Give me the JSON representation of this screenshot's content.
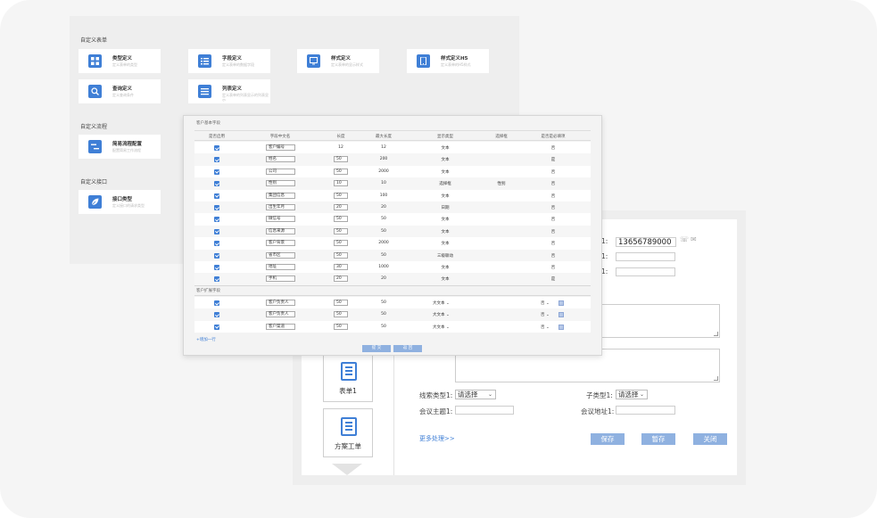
{
  "custom_form": {
    "section_title": "自定义表单",
    "cards": [
      {
        "title": "类型定义",
        "desc": "定义表单的类型",
        "icon": "grid-icon"
      },
      {
        "title": "字段定义",
        "desc": "定义表单的数据字段",
        "icon": "list-icon"
      },
      {
        "title": "样式定义",
        "desc": "定义表单的显示样式",
        "icon": "monitor-icon"
      },
      {
        "title": "样式定义H5",
        "desc": "定义表单的H5样式",
        "icon": "tablet-icon"
      },
      {
        "title": "查询定义",
        "desc": "定义查询条件",
        "icon": "search-icon"
      },
      {
        "title": "列表定义",
        "desc": "定义表单的列表显示的列表显示",
        "icon": "menu-icon"
      }
    ]
  },
  "custom_flow": {
    "section_title": "自定义流程",
    "card": {
      "title": "简易流程配置",
      "desc": "配置简易工作流程",
      "icon": "flow-icon"
    }
  },
  "custom_api": {
    "section_title": "自定义接口",
    "card": {
      "title": "接口类型",
      "desc": "定义接口的请求类型",
      "icon": "leaf-icon"
    }
  },
  "field_table": {
    "base_title": "客户基本字段",
    "columns": [
      "是否启用",
      "字段中文名",
      "长度",
      "最大长度",
      "显示类型",
      "选择框",
      "是否是必填项"
    ],
    "base_rows": [
      {
        "name": "客户编号",
        "len": "12",
        "max": "12",
        "type": "文本",
        "select": "",
        "required": "否",
        "len_box": false
      },
      {
        "name": "姓名",
        "len": "50",
        "max": "200",
        "type": "文本",
        "select": "",
        "required": "是",
        "len_box": true
      },
      {
        "name": "公司",
        "len": "50",
        "max": "2000",
        "type": "文本",
        "select": "",
        "required": "否",
        "len_box": true
      },
      {
        "name": "性别",
        "len": "10",
        "max": "10",
        "type": "选择框",
        "select": "性别",
        "required": "否",
        "len_box": true
      },
      {
        "name": "集团信息",
        "len": "50",
        "max": "100",
        "type": "文本",
        "select": "",
        "required": "否",
        "len_box": true
      },
      {
        "name": "出生年月",
        "len": "20",
        "max": "20",
        "type": "日期",
        "select": "",
        "required": "否",
        "len_box": true
      },
      {
        "name": "微信号",
        "len": "50",
        "max": "50",
        "type": "文本",
        "select": "",
        "required": "否",
        "len_box": true
      },
      {
        "name": "信息来源",
        "len": "50",
        "max": "50",
        "type": "文本",
        "select": "",
        "required": "否",
        "len_box": true
      },
      {
        "name": "客户背景",
        "len": "50",
        "max": "2000",
        "type": "文本",
        "select": "",
        "required": "否",
        "len_box": true
      },
      {
        "name": "省市区",
        "len": "50",
        "max": "50",
        "type": "三级联动",
        "select": "",
        "required": "否",
        "len_box": true
      },
      {
        "name": "地址",
        "len": "30",
        "max": "1000",
        "type": "文本",
        "select": "",
        "required": "否",
        "len_box": true
      },
      {
        "name": "手机",
        "len": "20",
        "max": "20",
        "type": "文本",
        "select": "",
        "required": "是",
        "len_box": true
      }
    ],
    "ext_title": "客户扩展字段",
    "ext_rows": [
      {
        "name": "客户负责人",
        "len": "50",
        "max": "50",
        "type": "大文本",
        "required": "否"
      },
      {
        "name": "客户负责人",
        "len": "50",
        "max": "50",
        "type": "大文本",
        "required": "否"
      },
      {
        "name": "客户渠道",
        "len": "50",
        "max": "50",
        "type": "大文本",
        "required": "否"
      }
    ],
    "add_row": "+增加一行",
    "submit": "提 交",
    "back": "返 回"
  },
  "customer_form": {
    "phone_label_suffix": "1:",
    "phone_value": "13656789000",
    "label2_suffix": "1:",
    "label3_suffix": "1:",
    "workflow_items": [
      "表单1",
      "方案工单"
    ],
    "lead_type_label": "线索类型1:",
    "lead_type_value": "请选择",
    "sub_type_label": "子类型1:",
    "sub_type_value": "请选择",
    "meeting_topic_label": "会议主题1:",
    "meeting_addr_label": "会议地址1:",
    "more_link": "更多处理>>",
    "save": "保存",
    "draft": "暂存",
    "close": "关闭"
  },
  "colors": {
    "accent": "#3f7fd6",
    "button": "#8fb1e0"
  }
}
